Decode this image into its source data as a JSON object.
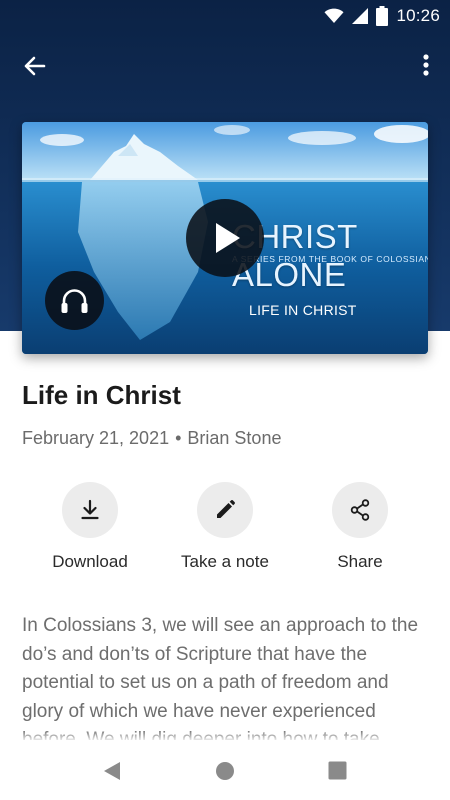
{
  "status_bar": {
    "time": "10:26",
    "icons": [
      "wifi-icon",
      "cellular-signal-icon",
      "battery-icon"
    ]
  },
  "app_bar": {
    "back_icon": "arrow-left-icon",
    "more_icon": "more-vertical-icon"
  },
  "media": {
    "artwork_title": "CHRIST ALONE",
    "artwork_subtitle": "A SERIES FROM THE BOOK OF COLOSSIANS",
    "artwork_series": "LIFE IN CHRIST",
    "play_icon": "play-icon",
    "audio_icon": "headphones-icon"
  },
  "sermon": {
    "title": "Life in Christ",
    "date": "February 21, 2021",
    "separator": "•",
    "speaker": "Brian Stone"
  },
  "actions": [
    {
      "label": "Download",
      "icon": "download-icon"
    },
    {
      "label": "Take a note",
      "icon": "pencil-icon"
    },
    {
      "label": "Share",
      "icon": "share-icon"
    }
  ],
  "description": "In Colossians 3, we will see an approach to the do’s and don’ts of Scripture that have the potential to set us on a path of freedom and glory of which we have never experienced before. We will dig deeper into how to take",
  "nav_bar": {
    "icons": [
      "back-triangle-icon",
      "home-circle-icon",
      "recents-square-icon"
    ]
  },
  "colors": {
    "header_dark": "#0b2245",
    "header_light": "#173a6b",
    "title_text": "#1b1b1b",
    "meta_text": "#6b6b6b",
    "action_circle": "#ececec"
  }
}
